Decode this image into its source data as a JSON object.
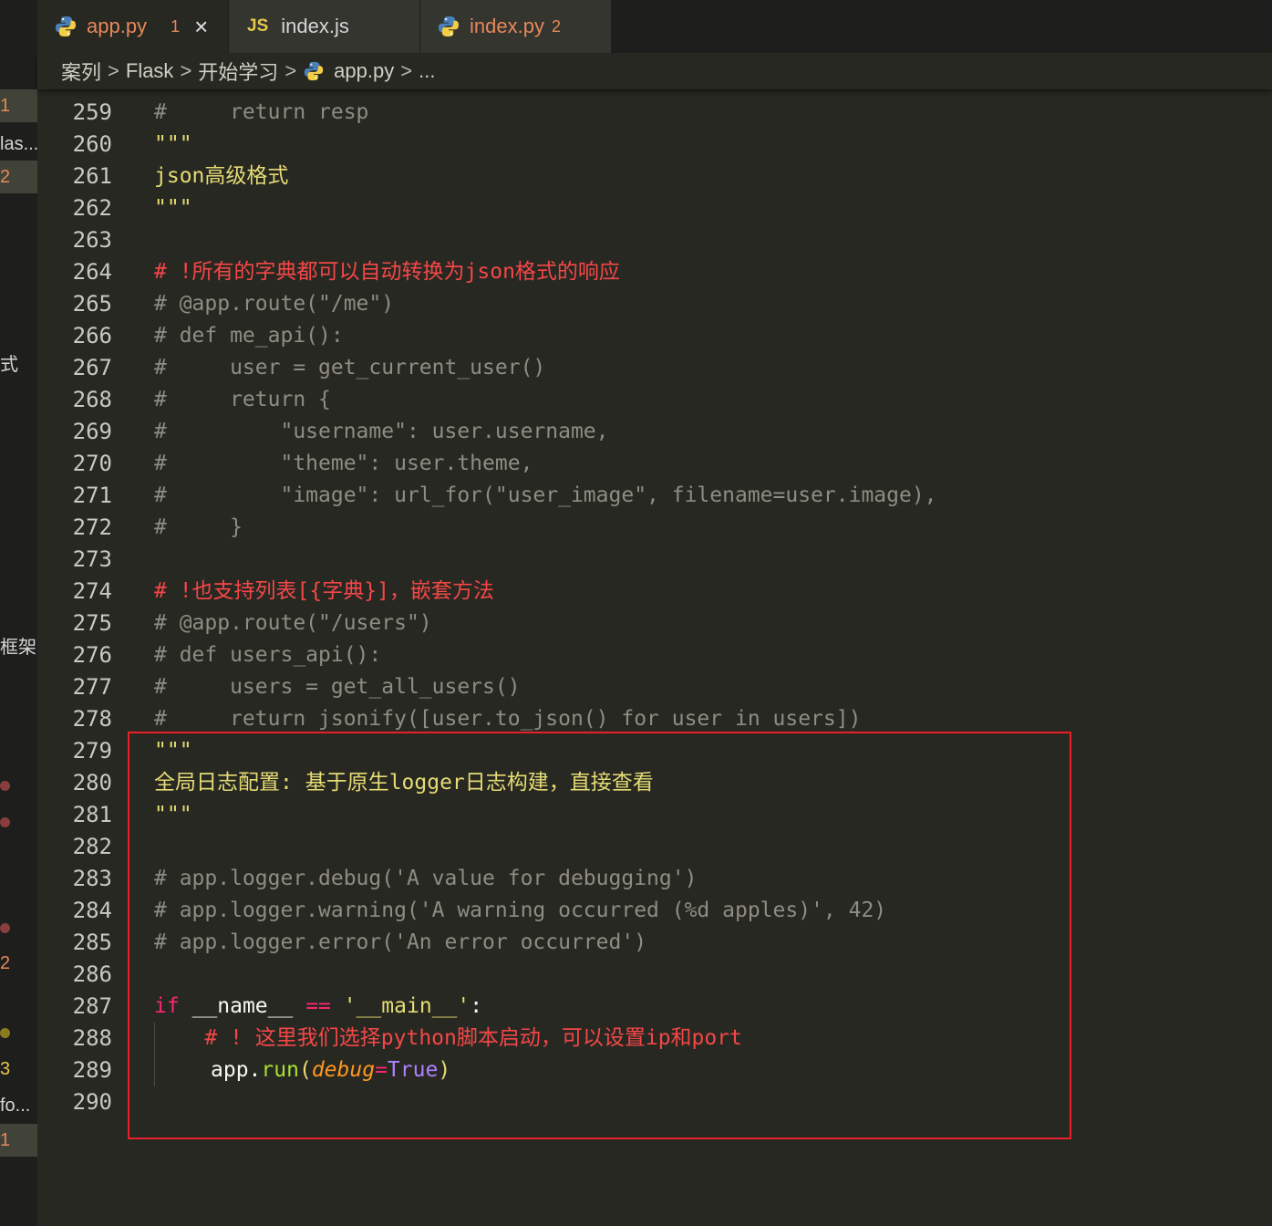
{
  "sidebar": {
    "items": [
      {
        "label": "1"
      },
      {
        "label": "las..."
      },
      {
        "label": "2"
      },
      {
        "label": "式"
      },
      {
        "label": "框架"
      },
      {
        "label": "2"
      },
      {
        "label": "3"
      },
      {
        "label": "fo..."
      },
      {
        "label": "1"
      }
    ],
    "dot_colors": {
      "red": "#8a3d3d",
      "yellow": "#8c7a1c"
    }
  },
  "tabs": [
    {
      "label": "app.py",
      "count": "1",
      "icon": "python-icon",
      "close": "×",
      "color": "#e5885b"
    },
    {
      "label": "index.js",
      "icon_text": "JS",
      "icon": "javascript-icon",
      "color": "#d6d6d6"
    },
    {
      "label": "index.py",
      "count": "2",
      "icon": "python-icon",
      "color": "#e5885b"
    }
  ],
  "breadcrumb": {
    "parts": [
      "案列",
      "Flask",
      "开始学习",
      "app.py",
      "..."
    ],
    "separator": ">"
  },
  "editor": {
    "lines": [
      {
        "num": "259",
        "text": "#     return resp"
      },
      {
        "num": "260",
        "text": "\"\"\""
      },
      {
        "num": "261",
        "text": "json高级格式"
      },
      {
        "num": "262",
        "text": "\"\"\""
      },
      {
        "num": "263",
        "text": ""
      },
      {
        "num": "264",
        "text": "# !所有的字典都可以自动转换为json格式的响应"
      },
      {
        "num": "265",
        "text": "# @app.route(\"/me\")"
      },
      {
        "num": "266",
        "text": "# def me_api():"
      },
      {
        "num": "267",
        "text": "#     user = get_current_user()"
      },
      {
        "num": "268",
        "text": "#     return {"
      },
      {
        "num": "269",
        "text": "#         \"username\": user.username,"
      },
      {
        "num": "270",
        "text": "#         \"theme\": user.theme,"
      },
      {
        "num": "271",
        "text": "#         \"image\": url_for(\"user_image\", filename=user.image),"
      },
      {
        "num": "272",
        "text": "#     }"
      },
      {
        "num": "273",
        "text": ""
      },
      {
        "num": "274",
        "text": "# !也支持列表[{字典}]，嵌套方法"
      },
      {
        "num": "275",
        "text": "# @app.route(\"/users\")"
      },
      {
        "num": "276",
        "text": "# def users_api():"
      },
      {
        "num": "277",
        "text": "#     users = get_all_users()"
      },
      {
        "num": "278",
        "text": "#     return jsonify([user.to_json() for user in users])"
      },
      {
        "num": "279",
        "text": "\"\"\""
      },
      {
        "num": "280",
        "text": "全局日志配置: 基于原生logger日志构建，直接查看"
      },
      {
        "num": "281",
        "text": "\"\"\""
      },
      {
        "num": "282",
        "text": ""
      },
      {
        "num": "283",
        "text": "# app.logger.debug('A value for debugging')"
      },
      {
        "num": "284",
        "text": "# app.logger.warning('A warning occurred (%d apples)', 42)"
      },
      {
        "num": "285",
        "text": "# app.logger.error('An error occurred')"
      },
      {
        "num": "286",
        "text": ""
      },
      {
        "num": "287",
        "text": ""
      },
      {
        "num": "288",
        "text": "    # ! 这里我们选择python脚本启动，可以设置ip和port"
      },
      {
        "num": "289",
        "text": ""
      },
      {
        "num": "290",
        "text": ""
      }
    ],
    "line_287": {
      "kw": "if",
      "name": "__name__",
      "op": "==",
      "str": "'__main__'",
      "colon": ":"
    },
    "line_289": {
      "obj": "app",
      "dot": ".",
      "fn": "run",
      "open": "(",
      "param": "debug",
      "eq": "=",
      "const": "True",
      "close": ")"
    }
  },
  "colors": {
    "background": "#272822",
    "highlight_box": "#e8202a",
    "comment": "#8f8d82",
    "important_comment": "#f44747",
    "docstring": "#e6db74",
    "keyword": "#f92672"
  }
}
